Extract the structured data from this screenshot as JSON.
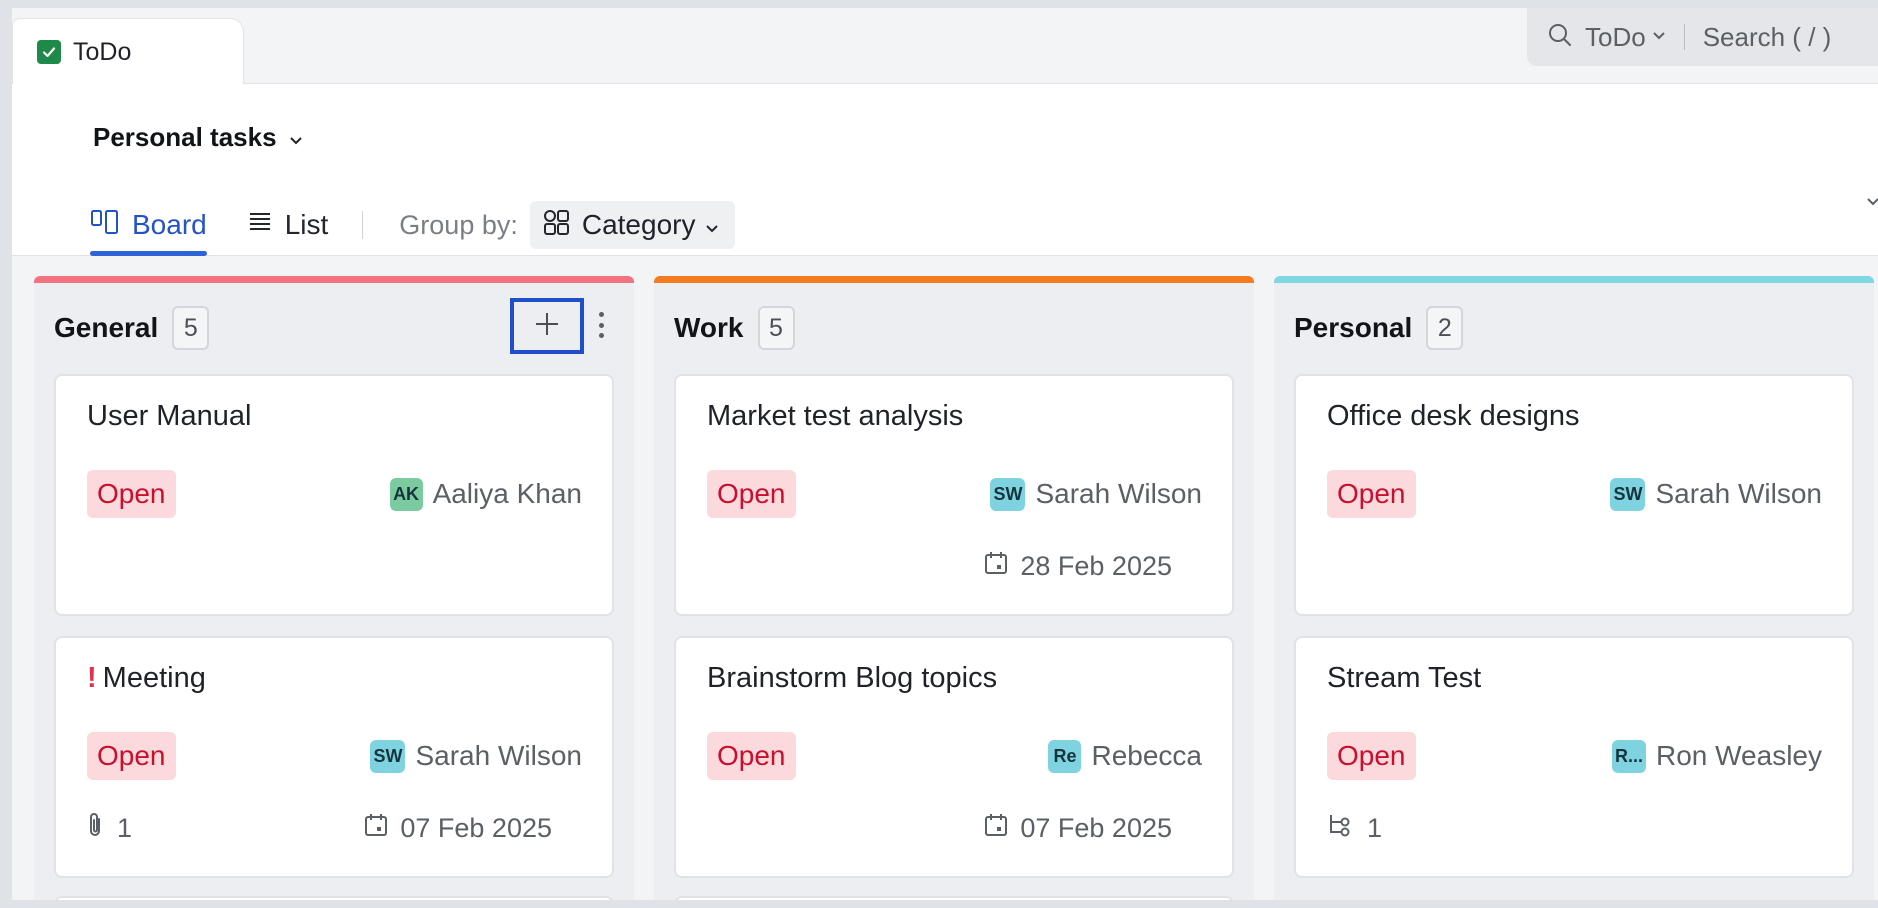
{
  "tab": {
    "title": "ToDo"
  },
  "search": {
    "scope": "ToDo",
    "placeholder": "Search ( / )"
  },
  "header": {
    "view_title": "Personal tasks",
    "tabs": [
      {
        "label": "Board",
        "active": true
      },
      {
        "label": "List",
        "active": false
      }
    ],
    "group_by_label": "Group by:",
    "group_by_value": "Category"
  },
  "columns": [
    {
      "title": "General",
      "count": "5",
      "color": "#f2727f",
      "cards": [
        {
          "title": "User Manual",
          "priority": "",
          "status": "Open",
          "assignee": {
            "initials": "AK",
            "name": "Aaliya Khan",
            "color": "#7ccba0"
          },
          "meta_left": "",
          "date": ""
        },
        {
          "title": "Meeting",
          "priority": "!",
          "status": "Open",
          "assignee": {
            "initials": "SW",
            "name": "Sarah Wilson",
            "color": "#7fd3e0"
          },
          "meta_left": "1",
          "meta_left_icon": "paperclip-icon",
          "date": "07 Feb 2025"
        }
      ]
    },
    {
      "title": "Work",
      "count": "5",
      "color": "#f47b20",
      "cards": [
        {
          "title": "Market test analysis",
          "priority": "",
          "status": "Open",
          "assignee": {
            "initials": "SW",
            "name": "Sarah Wilson",
            "color": "#7fd3e0"
          },
          "meta_left": "",
          "date": "28 Feb 2025"
        },
        {
          "title": "Brainstorm Blog topics",
          "priority": "",
          "status": "Open",
          "assignee": {
            "initials": "Re",
            "name": "Rebecca",
            "color": "#7fd3e0"
          },
          "meta_left": "",
          "date": "07 Feb 2025"
        }
      ]
    },
    {
      "title": "Personal",
      "count": "2",
      "color": "#7fd6e4",
      "cards": [
        {
          "title": "Office desk designs",
          "priority": "",
          "status": "Open",
          "assignee": {
            "initials": "SW",
            "name": "Sarah Wilson",
            "color": "#7fd3e0"
          },
          "meta_left": "",
          "date": ""
        },
        {
          "title": "Stream Test",
          "priority": "",
          "status": "Open",
          "assignee": {
            "initials": "R...",
            "name": "Ron Weasley",
            "color": "#7fd3e0"
          },
          "meta_left": "1",
          "meta_left_icon": "subtask-icon",
          "date": ""
        }
      ]
    }
  ]
}
